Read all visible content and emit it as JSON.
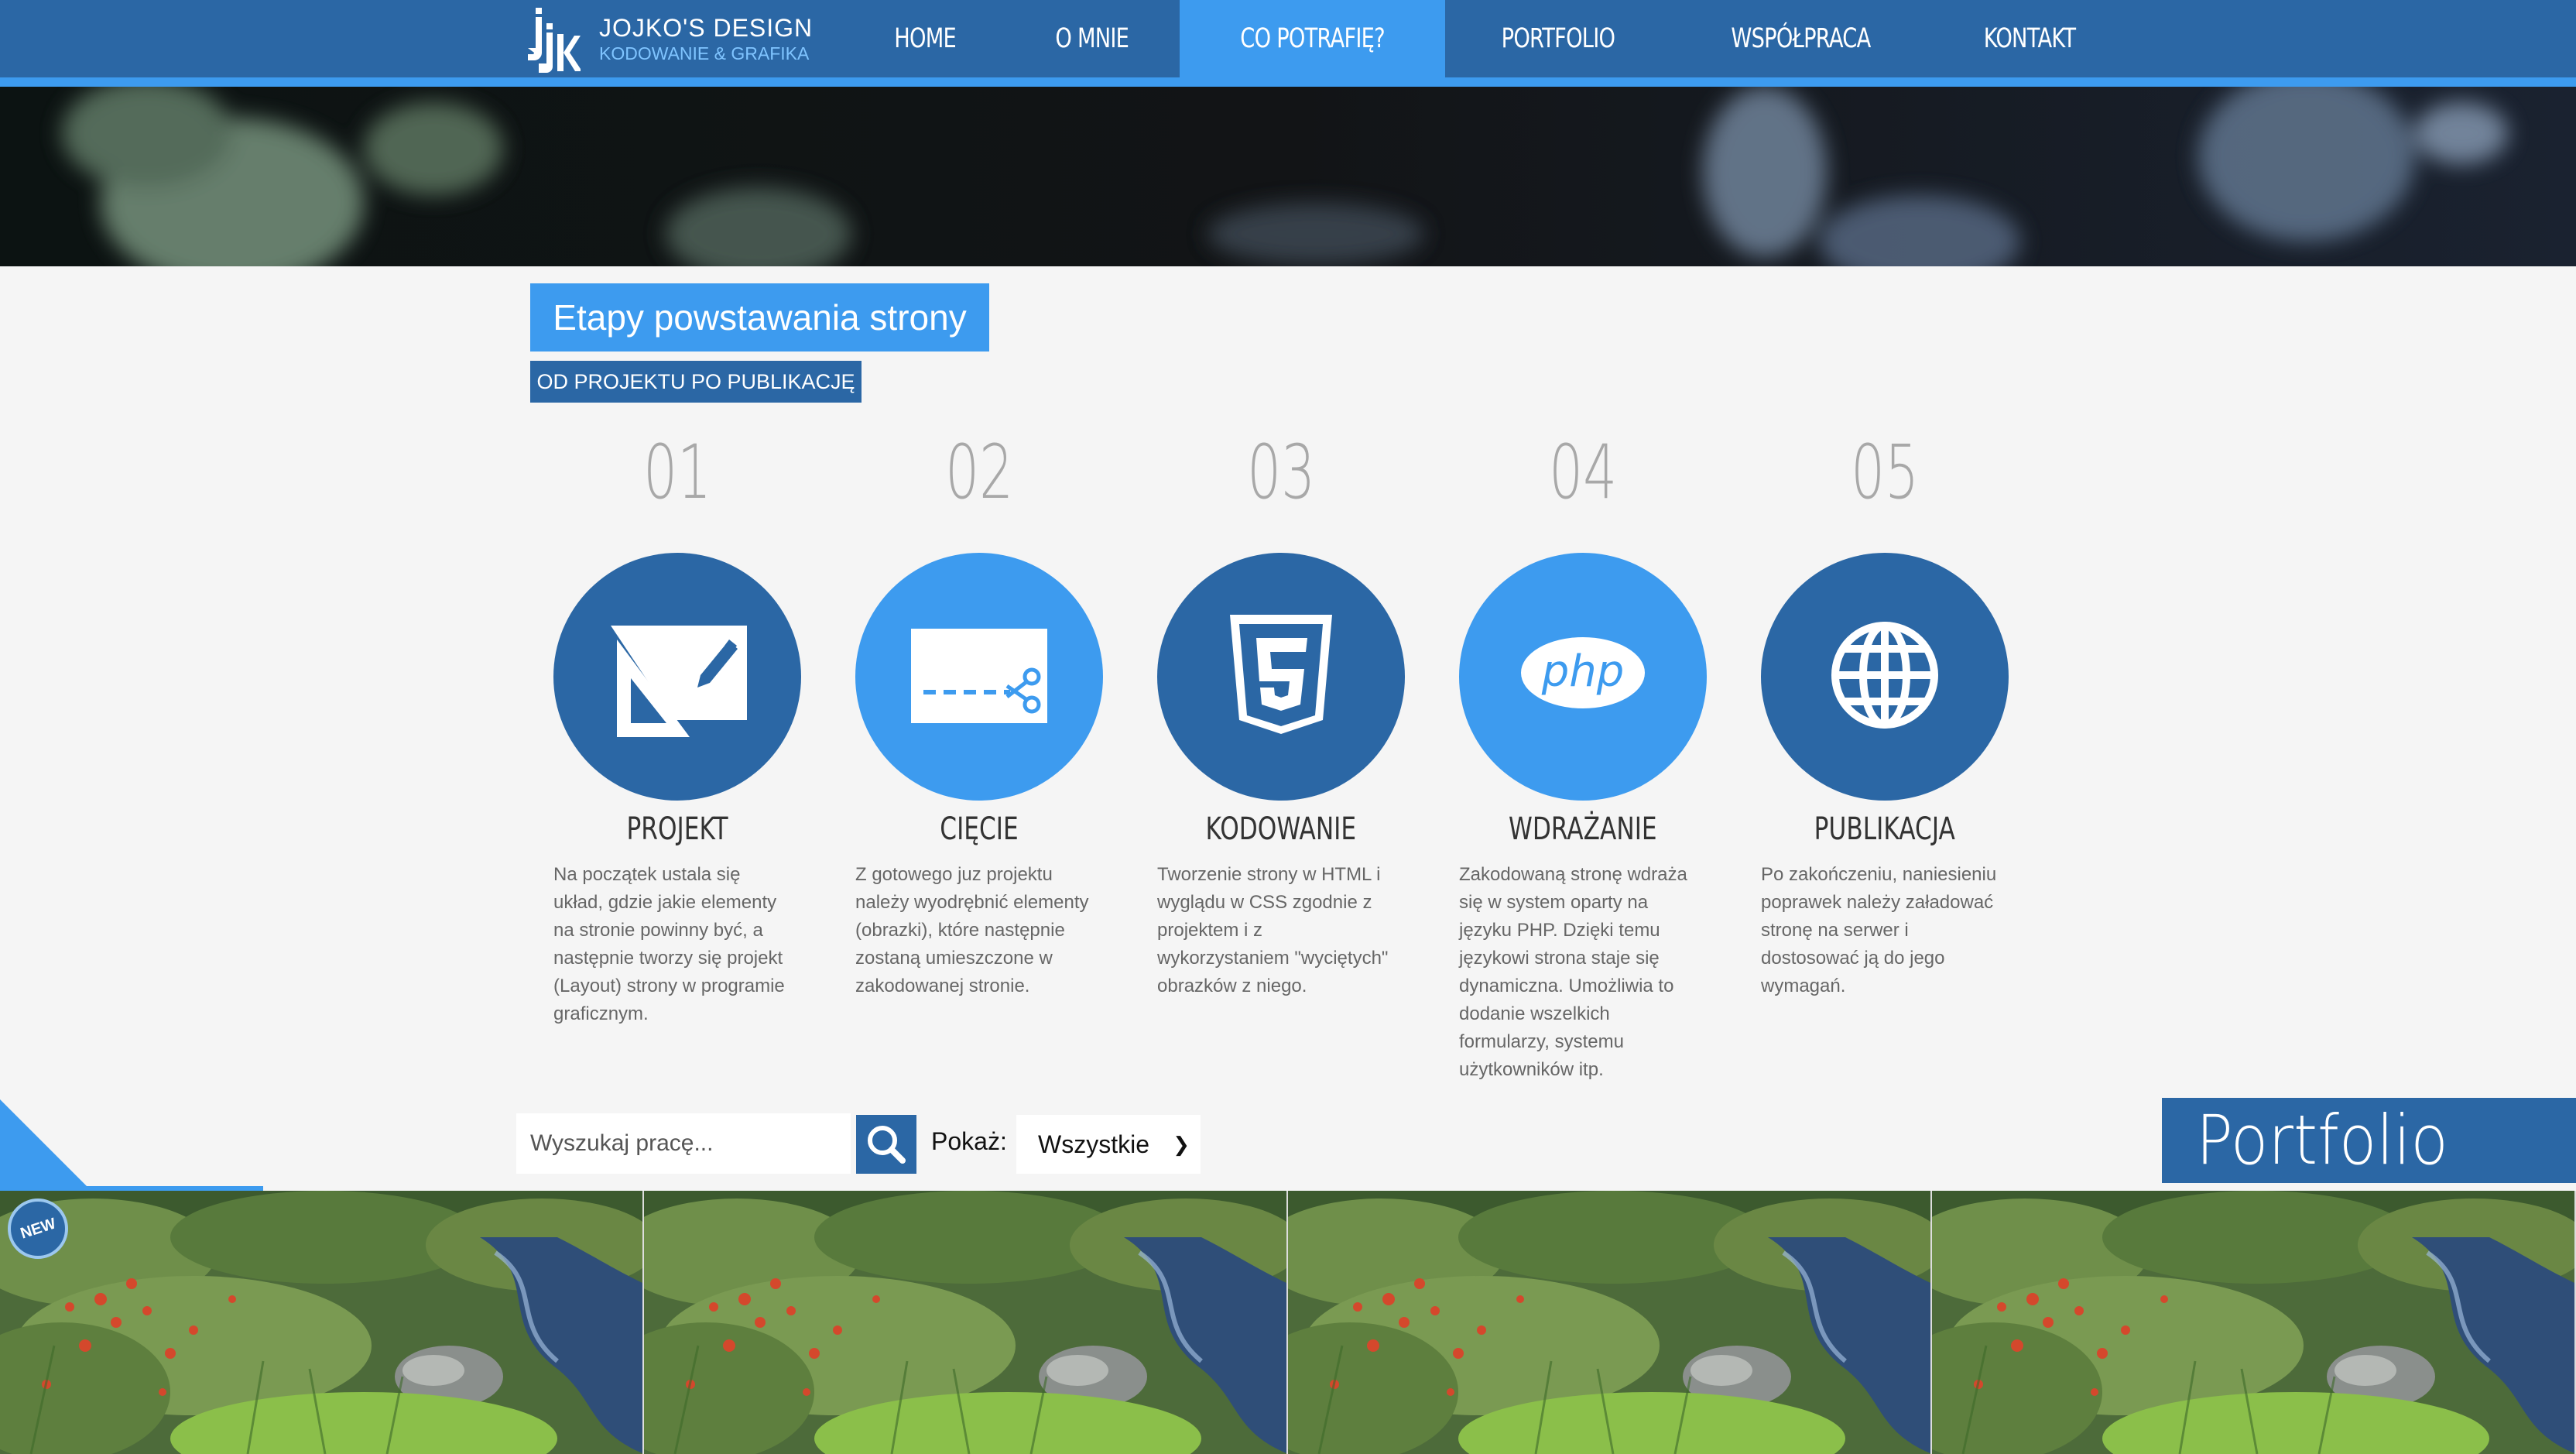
{
  "brand": {
    "title": "JOJKO'S DESIGN",
    "subtitle": "KODOWANIE & GRAFIKA",
    "logo_icon": "jjk-monogram-icon"
  },
  "nav": {
    "items": [
      {
        "label": "HOME",
        "active": false
      },
      {
        "label": "O MNIE",
        "active": false
      },
      {
        "label": "CO POTRAFIĘ?",
        "active": true
      },
      {
        "label": "PORTFOLIO",
        "active": false
      },
      {
        "label": "WSPÓŁPRACA",
        "active": false
      },
      {
        "label": "KONTAKT",
        "active": false
      }
    ]
  },
  "stages": {
    "title": "Etapy powstawania strony",
    "subtitle": "OD PROJEKTU PO PUBLIKACJĘ",
    "steps": [
      {
        "number": "01",
        "title": "PROJEKT",
        "icon": "design-tools-icon",
        "text": "Na początek ustala się układ, gdzie jakie elementy na stronie powinny być, a następnie tworzy się projekt (Layout) strony w programie graficznym."
      },
      {
        "number": "02",
        "title": "CIĘCIE",
        "icon": "scissors-cut-icon",
        "text": "Z gotowego juz projektu należy wyodrębnić elementy (obrazki), które następnie zostaną umieszczone w zakodowanej stronie."
      },
      {
        "number": "03",
        "title": "KODOWANIE",
        "icon": "html5-icon",
        "text": "Tworzenie strony w HTML i wyglądu w CSS zgodnie z projektem i z wykorzystaniem \"wyciętych\" obrazków z niego."
      },
      {
        "number": "04",
        "title": "WDRAŻANIE",
        "icon": "php-icon",
        "icon_text": "php",
        "text": "Zakodowaną stronę wdraża się w system oparty na języku PHP. Dzięki temu językowi strona staje się dynamiczna. Umożliwia to dodanie wszelkich formularzy, systemu użytkowników itp."
      },
      {
        "number": "05",
        "title": "PUBLIKACJA",
        "icon": "globe-icon",
        "text": "Po zakończeniu, naniesieniu poprawek należy załadować stronę na serwer i dostosować ją do jego wymagań."
      }
    ]
  },
  "portfolio": {
    "search_placeholder": "Wyszukaj pracę...",
    "search_value": "",
    "show_label": "Pokaż:",
    "filter_selected": "Wszystkie",
    "heading": "Portfolio",
    "badge": "NEW",
    "tiles": [
      {
        "name": "portfolio-tile-1"
      },
      {
        "name": "portfolio-tile-2"
      },
      {
        "name": "portfolio-tile-3"
      },
      {
        "name": "portfolio-tile-4"
      }
    ]
  },
  "colors": {
    "primary": "#2b67a5",
    "accent": "#3d9bef",
    "page_bg": "#f5f5f5",
    "number_gray": "#a8a8a8"
  }
}
